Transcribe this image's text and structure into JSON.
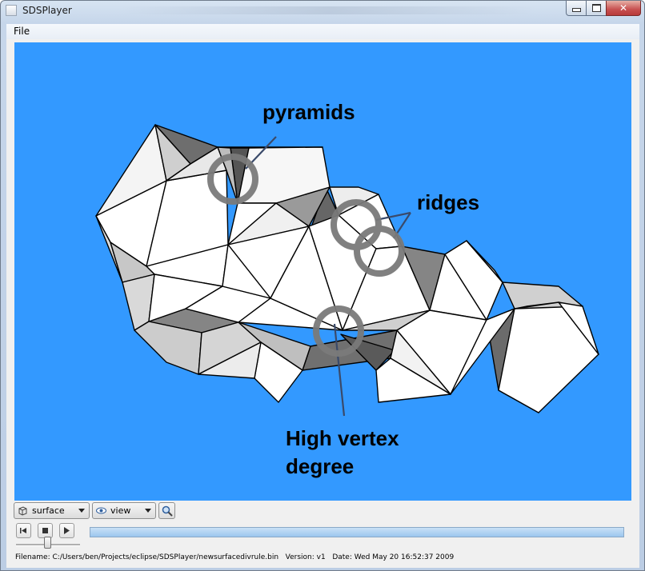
{
  "window": {
    "title": "SDSPlayer"
  },
  "menu": {
    "file": "File"
  },
  "annotations": {
    "pyramids": "pyramids",
    "ridges": "ridges",
    "vertex_line1": "High vertex",
    "vertex_line2": "degree"
  },
  "toolbar": {
    "surface_select": "surface",
    "view_select": "view"
  },
  "status": {
    "filename_label": "Filename:",
    "filename_value": "C:/Users/ben/Projects/eclipse/SDSPlayer/newsurfacedivrule.bin",
    "version_label": "Version:",
    "version_value": "v1",
    "date_label": "Date:",
    "date_value": "Wed May 20 16:52:37 2009"
  },
  "colors": {
    "viewport": "#3399ff",
    "annotation_ring": "#7a7a7a"
  },
  "icons": [
    "window-app-icon",
    "minimize-icon",
    "maximize-icon",
    "close-icon",
    "surface-icon",
    "eye-icon",
    "zoom-icon",
    "skip-back-icon",
    "stop-icon",
    "play-icon"
  ]
}
